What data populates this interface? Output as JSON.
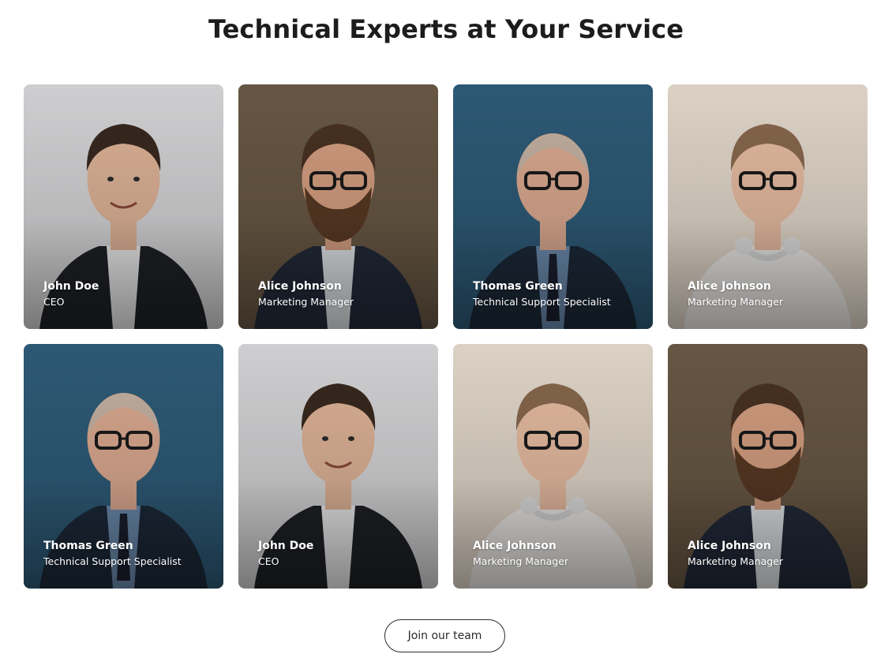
{
  "heading": "Technical Experts at Your Service",
  "members": [
    {
      "name": "John Doe",
      "role": "CEO",
      "avatar": "person-young-suit",
      "bg": "#d9d9db"
    },
    {
      "name": "Alice Johnson",
      "role": "Marketing Manager",
      "avatar": "person-bearded-glasses",
      "bg": "#6b5a46"
    },
    {
      "name": "Thomas Green",
      "role": "Technical Support Specialist",
      "avatar": "person-senior-glasses",
      "bg": "#2f5d7a"
    },
    {
      "name": "Alice Johnson",
      "role": "Marketing Manager",
      "avatar": "person-headphones",
      "bg": "#e7dccf"
    },
    {
      "name": "Thomas Green",
      "role": "Technical Support Specialist",
      "avatar": "person-senior-glasses",
      "bg": "#2f5d7a"
    },
    {
      "name": "John Doe",
      "role": "CEO",
      "avatar": "person-young-suit",
      "bg": "#d9d9db"
    },
    {
      "name": "Alice Johnson",
      "role": "Marketing Manager",
      "avatar": "person-headphones",
      "bg": "#e7dccf"
    },
    {
      "name": "Alice Johnson",
      "role": "Marketing Manager",
      "avatar": "person-bearded-glasses",
      "bg": "#6b5a46"
    }
  ],
  "cta": {
    "label": "Join our team"
  },
  "colors": {
    "text": "#1c1c1c",
    "button_border": "#2b2b2b"
  }
}
